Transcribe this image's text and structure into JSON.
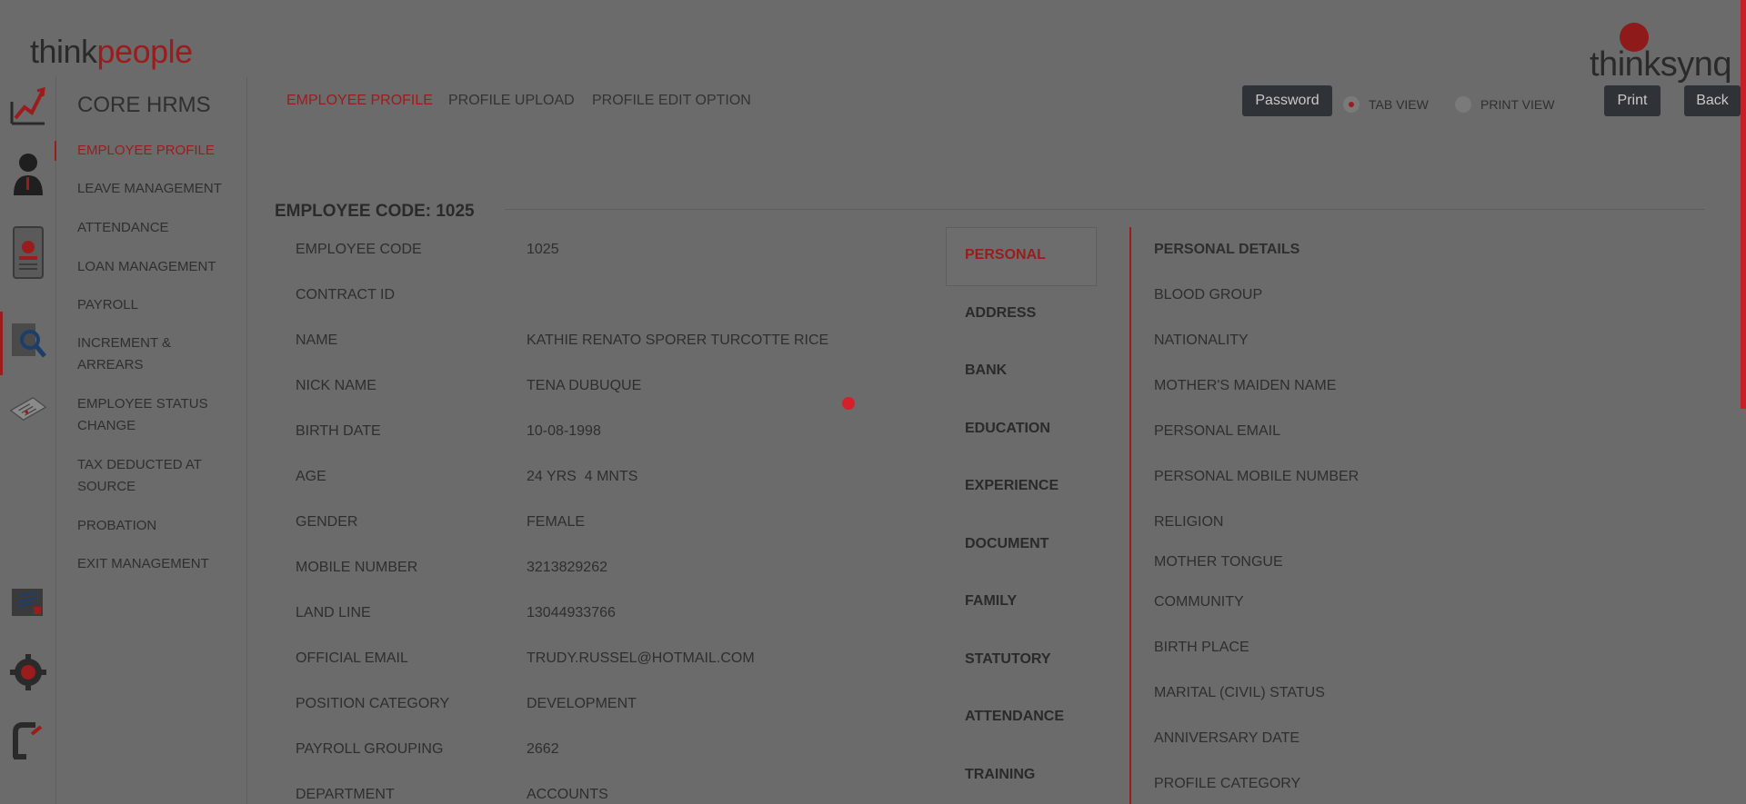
{
  "brand": {
    "left_logo_part1": "think",
    "left_logo_part2": "people",
    "right_logo": "thinksynq",
    "accent_color": "#9b1c1c"
  },
  "icon_rail": {
    "icons": [
      "dashboard-chart-icon",
      "person-icon",
      "id-card-icon",
      "magnifier-icon",
      "document-icon",
      "notes-icon",
      "settings-gear-icon",
      "logout-icon"
    ]
  },
  "module": {
    "title": "CORE HRMS",
    "items": [
      {
        "label": "EMPLOYEE PROFILE"
      },
      {
        "label": "LEAVE MANAGEMENT"
      },
      {
        "label": "ATTENDANCE"
      },
      {
        "label": "LOAN MANAGEMENT"
      },
      {
        "label": "PAYROLL"
      },
      {
        "label": "INCREMENT & ARREARS"
      },
      {
        "label": "EMPLOYEE STATUS CHANGE"
      },
      {
        "label": "TAX DEDUCTED AT SOURCE"
      },
      {
        "label": "PROBATION"
      },
      {
        "label": "EXIT MANAGEMENT"
      }
    ]
  },
  "top_tabs": [
    {
      "label": "EMPLOYEE PROFILE"
    },
    {
      "label": "PROFILE UPLOAD"
    },
    {
      "label": "PROFILE EDIT OPTION"
    }
  ],
  "header": {
    "password_label": "Password",
    "tab_view_label": "TAB VIEW",
    "print_view_label": "PRINT VIEW",
    "print_label": "Print",
    "back_label": "Back"
  },
  "employee": {
    "heading": "EMPLOYEE CODE: 1025",
    "fields": [
      {
        "label": "EMPLOYEE CODE",
        "value": "1025"
      },
      {
        "label": "CONTRACT ID",
        "value": ""
      },
      {
        "label": "NAME",
        "value": "KATHIE RENATO SPORER TURCOTTE RICE"
      },
      {
        "label": "NICK NAME",
        "value": "TENA DUBUQUE"
      },
      {
        "label": "BIRTH DATE",
        "value": "10-08-1998"
      },
      {
        "label": "AGE",
        "value": "24 YRS  4 MNTS"
      },
      {
        "label": "GENDER",
        "value": "FEMALE"
      },
      {
        "label": "MOBILE NUMBER",
        "value": "3213829262"
      },
      {
        "label": "LAND LINE",
        "value": "13044933766"
      },
      {
        "label": "OFFICIAL EMAIL",
        "value": "TRUDY.RUSSEL@HOTMAIL.COM"
      },
      {
        "label": "POSITION CATEGORY",
        "value": "DEVELOPMENT"
      },
      {
        "label": "PAYROLL GROUPING",
        "value": "2662"
      },
      {
        "label": "DEPARTMENT",
        "value": "ACCOUNTS"
      }
    ]
  },
  "detail_tabs": [
    {
      "label": "PERSONAL"
    },
    {
      "label": "ADDRESS"
    },
    {
      "label": "BANK"
    },
    {
      "label": "EDUCATION"
    },
    {
      "label": "EXPERIENCE"
    },
    {
      "label": "DOCUMENT"
    },
    {
      "label": "FAMILY"
    },
    {
      "label": "STATUTORY"
    },
    {
      "label": "ATTENDANCE"
    },
    {
      "label": "TRAINING"
    }
  ],
  "personal_details": {
    "heading": "PERSONAL DETAILS",
    "items": [
      "BLOOD GROUP",
      "NATIONALITY",
      "MOTHER'S MAIDEN NAME",
      "PERSONAL EMAIL",
      "PERSONAL MOBILE NUMBER",
      "RELIGION",
      "MOTHER TONGUE",
      "COMMUNITY",
      "BIRTH PLACE",
      "MARITAL (CIVIL) STATUS",
      "ANNIVERSARY DATE",
      "PROFILE CATEGORY"
    ]
  }
}
